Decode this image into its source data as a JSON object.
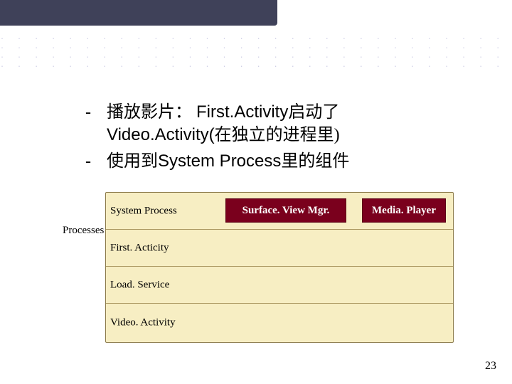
{
  "bullets": {
    "b1_pre": "播放影片： ",
    "b1_code1": "First.Activity",
    "b1_mid": "启动了",
    "b1_line2_code": "Video.Activity(",
    "b1_line2_tail": "在独立的进程里)",
    "b2_pre": "使用到",
    "b2_bold": "System Process",
    "b2_tail": "里的组件"
  },
  "diagram": {
    "processes_label": "Processes",
    "rows": {
      "r0": "System Process",
      "r1": "First. Acticity",
      "r2": "Load. Service",
      "r3": "Video. Activity"
    },
    "components": {
      "svm": "Surface. View Mgr.",
      "mp": "Media. Player"
    }
  },
  "page_number": "23"
}
